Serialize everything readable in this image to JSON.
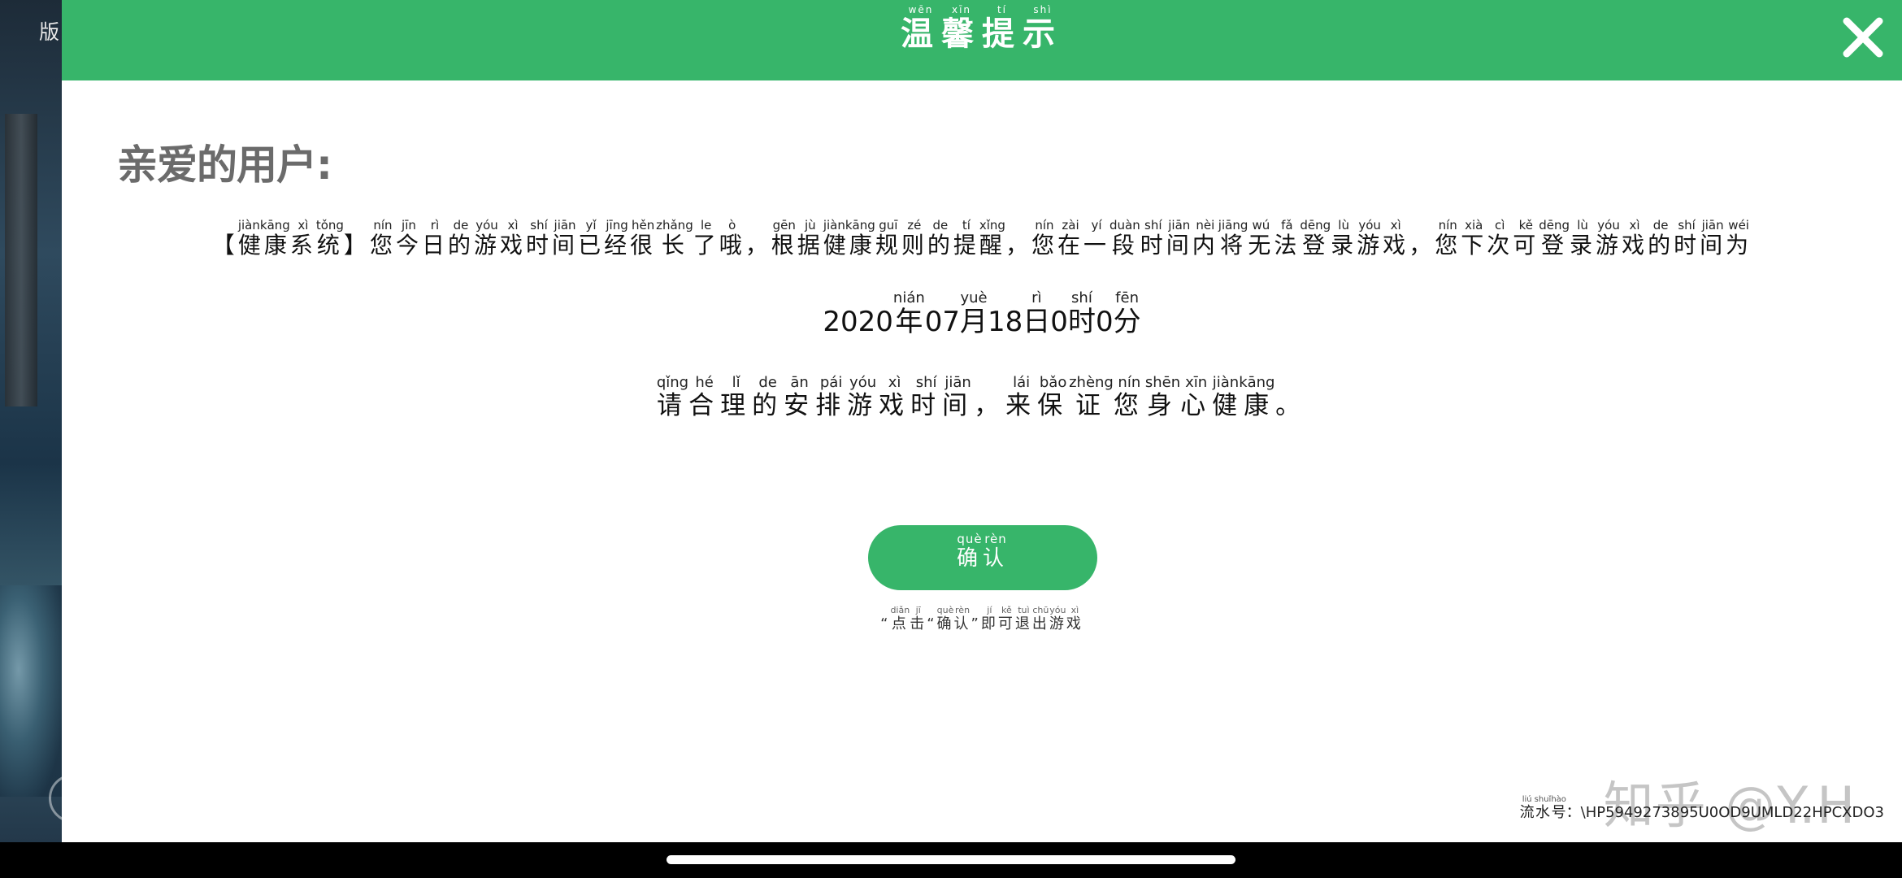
{
  "side_label": "版",
  "header": {
    "title": [
      {
        "char": "温",
        "py": "wēn"
      },
      {
        "char": "馨",
        "py": "xīn"
      },
      {
        "char": "提",
        "py": "tí"
      },
      {
        "char": "示",
        "py": "shì"
      }
    ],
    "close_icon": "close-icon",
    "color": "#37b56a"
  },
  "greeting": "亲爱的用户:",
  "notice_line1": [
    {
      "char": "【",
      "py": ""
    },
    {
      "char": "健康",
      "py": "jiànkāng"
    },
    {
      "char": "系",
      "py": "xì"
    },
    {
      "char": "统",
      "py": "tǒng"
    },
    {
      "char": "】",
      "py": ""
    },
    {
      "char": "您",
      "py": "nín"
    },
    {
      "char": "今",
      "py": "jīn"
    },
    {
      "char": "日",
      "py": "rì"
    },
    {
      "char": "的",
      "py": "de"
    },
    {
      "char": "游",
      "py": "yóu"
    },
    {
      "char": "戏",
      "py": "xì"
    },
    {
      "char": "时",
      "py": "shí"
    },
    {
      "char": "间",
      "py": "jiān"
    },
    {
      "char": "已",
      "py": "yǐ"
    },
    {
      "char": "经",
      "py": "jīng"
    },
    {
      "char": "很",
      "py": "hěn"
    },
    {
      "char": "长",
      "py": "zhǎng"
    },
    {
      "char": "了",
      "py": "le"
    },
    {
      "char": "哦",
      "py": "ò"
    },
    {
      "char": "，",
      "py": ""
    },
    {
      "char": "根",
      "py": "gēn"
    },
    {
      "char": "据",
      "py": "jù"
    },
    {
      "char": "健康",
      "py": "jiànkāng"
    },
    {
      "char": "规",
      "py": "guī"
    },
    {
      "char": "则",
      "py": "zé"
    },
    {
      "char": "的",
      "py": "de"
    },
    {
      "char": "提",
      "py": "tí"
    },
    {
      "char": "醒",
      "py": "xǐng"
    },
    {
      "char": "，",
      "py": ""
    },
    {
      "char": "您",
      "py": "nín"
    },
    {
      "char": "在",
      "py": "zài"
    },
    {
      "char": "一",
      "py": "yí"
    },
    {
      "char": "段",
      "py": "duàn"
    },
    {
      "char": "时",
      "py": "shí"
    },
    {
      "char": "间",
      "py": "jiān"
    },
    {
      "char": "内",
      "py": "nèi"
    },
    {
      "char": "将",
      "py": "jiāng"
    },
    {
      "char": "无",
      "py": "wú"
    },
    {
      "char": "法",
      "py": "fǎ"
    },
    {
      "char": "登",
      "py": "dēng"
    },
    {
      "char": "录",
      "py": "lù"
    },
    {
      "char": "游",
      "py": "yóu"
    },
    {
      "char": "戏",
      "py": "xì"
    },
    {
      "char": "，",
      "py": ""
    },
    {
      "char": "您",
      "py": "nín"
    },
    {
      "char": "下",
      "py": "xià"
    },
    {
      "char": "次",
      "py": "cì"
    },
    {
      "char": "可",
      "py": "kě"
    },
    {
      "char": "登",
      "py": "dēng"
    },
    {
      "char": "录",
      "py": "lù"
    },
    {
      "char": "游",
      "py": "yóu"
    },
    {
      "char": "戏",
      "py": "xì"
    },
    {
      "char": "的",
      "py": "de"
    },
    {
      "char": "时",
      "py": "shí"
    },
    {
      "char": "间",
      "py": "jiān"
    },
    {
      "char": "为",
      "py": "wéi"
    }
  ],
  "notice_line2": [
    {
      "char": "2020",
      "py": ""
    },
    {
      "char": "年",
      "py": "nián"
    },
    {
      "char": "07",
      "py": ""
    },
    {
      "char": "月",
      "py": "yuè"
    },
    {
      "char": "18",
      "py": ""
    },
    {
      "char": "日",
      "py": "rì"
    },
    {
      "char": "0",
      "py": ""
    },
    {
      "char": "时",
      "py": "shí"
    },
    {
      "char": "0",
      "py": ""
    },
    {
      "char": "分",
      "py": "fēn"
    }
  ],
  "notice_line3": [
    {
      "char": "请",
      "py": "qǐng"
    },
    {
      "char": "合",
      "py": "hé"
    },
    {
      "char": "理",
      "py": "lǐ"
    },
    {
      "char": "的",
      "py": "de"
    },
    {
      "char": "安",
      "py": "ān"
    },
    {
      "char": "排",
      "py": "pái"
    },
    {
      "char": "游",
      "py": "yóu"
    },
    {
      "char": "戏",
      "py": "xì"
    },
    {
      "char": "时",
      "py": "shí"
    },
    {
      "char": "间",
      "py": "jiān"
    },
    {
      "char": "，",
      "py": ""
    },
    {
      "char": "来",
      "py": "lái"
    },
    {
      "char": "保",
      "py": "bǎo"
    },
    {
      "char": "证",
      "py": "zhèng"
    },
    {
      "char": "您",
      "py": "nín"
    },
    {
      "char": "身",
      "py": "shēn"
    },
    {
      "char": "心",
      "py": "xīn"
    },
    {
      "char": "健康",
      "py": "jiànkāng"
    },
    {
      "char": "。",
      "py": ""
    }
  ],
  "confirm_button": [
    {
      "char": "确",
      "py": "què"
    },
    {
      "char": "认",
      "py": "rèn"
    }
  ],
  "hint": [
    {
      "char": "“",
      "py": ""
    },
    {
      "char": "点",
      "py": "diǎn"
    },
    {
      "char": "击",
      "py": "jī"
    },
    {
      "char": "“",
      "py": ""
    },
    {
      "char": "确",
      "py": "què"
    },
    {
      "char": "认",
      "py": "rèn"
    },
    {
      "char": "”",
      "py": ""
    },
    {
      "char": "即",
      "py": "jí"
    },
    {
      "char": "可",
      "py": "kě"
    },
    {
      "char": "退",
      "py": "tuì"
    },
    {
      "char": "出",
      "py": "chū"
    },
    {
      "char": "游",
      "py": "yóu"
    },
    {
      "char": "戏",
      "py": "xì"
    }
  ],
  "serial": {
    "label": [
      {
        "char": "流",
        "py": "liú"
      },
      {
        "char": "水",
        "py": "shuǐ"
      },
      {
        "char": "号",
        "py": "hào"
      }
    ],
    "value": "：\\HP5949273895U0OD9UMLD22HPCXDO3"
  },
  "watermark": "知乎 @Y.H"
}
